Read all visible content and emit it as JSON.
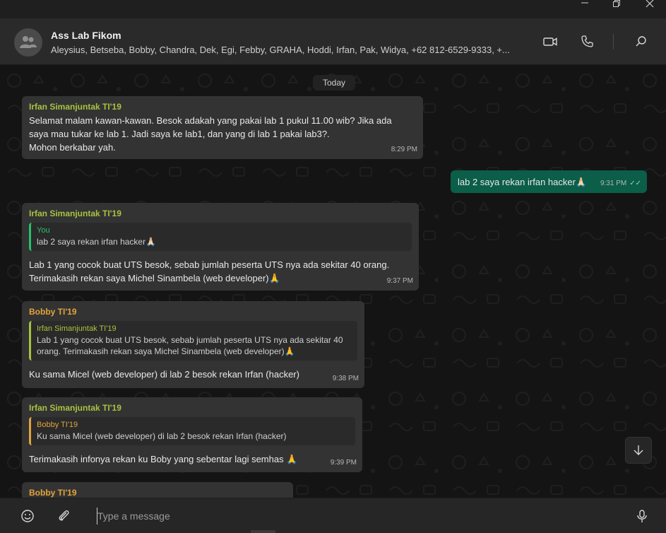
{
  "window": {
    "controls": {
      "minimize": "minimize-icon",
      "maximize": "maximize-icon",
      "close": "close-icon"
    }
  },
  "header": {
    "title": "Ass Lab Fikom",
    "members": "Aleysius, Betseba, Bobby, Chandra, Dek, Egi, Febby, GRAHA, Hoddi, Irfan, Pak, Widya, +62 812-6529-9333, +...",
    "icons": [
      "group-avatar-icon",
      "video-call-icon",
      "voice-call-icon",
      "search-icon"
    ]
  },
  "chat": {
    "date_label": "Today",
    "messages": [
      {
        "sender": "Irfan Simanjuntak TI'19",
        "lines": [
          "Selamat malam kawan-kawan. Besok adakah yang pakai lab 1 pukul 11.00 wib? Jika ada",
          "saya mau tukar ke lab 1. Jadi saya ke lab1, dan yang di lab 1 pakai lab3?.",
          "Mohon berkabar yah."
        ],
        "time": "8:29 PM"
      },
      {
        "sender": "",
        "text": "lab 2 saya rekan irfan hacker🙏🏻",
        "time": "9:31 PM",
        "ticks": "✓✓",
        "outgoing": true
      },
      {
        "sender": "Irfan Simanjuntak TI'19",
        "quote": {
          "name": "You",
          "text": "lab 2 saya rekan irfan hacker🙏🏻"
        },
        "lines": [
          "Lab 1 yang cocok buat UTS besok, sebab jumlah peserta UTS nya ada sekitar 40 orang.",
          "Terimakasih rekan saya Michel Sinambela (web developer)🙏"
        ],
        "time": "9:37 PM"
      },
      {
        "sender": "Bobby TI'19",
        "quote": {
          "name": "Irfan Simanjuntak TI'19",
          "lines": [
            "Lab 1 yang cocok buat UTS besok, sebab jumlah peserta UTS nya ada sekitar 40",
            "orang. Terimakasih rekan saya Michel Sinambela (web developer)🙏"
          ]
        },
        "text": "Ku sama Micel (web developer) di lab 2 besok rekan Irfan (hacker)",
        "time": "9:38 PM"
      },
      {
        "sender": "Irfan Simanjuntak TI'19",
        "quote": {
          "name": "Bobby TI'19",
          "text": "Ku sama Micel (web developer) di lab 2 besok rekan Irfan (hacker)"
        },
        "text": "Terimakasih infonya rekan ku Boby yang sebentar lagi semhas 🙏",
        "time": "9:39 PM"
      },
      {
        "sender": "Bobby TI'19"
      }
    ]
  },
  "composer": {
    "placeholder": "Type a message",
    "icons": [
      "emoji-icon",
      "attach-icon",
      "microphone-icon"
    ]
  },
  "colors": {
    "incoming_bubble": "#333333",
    "outgoing_bubble": "#0b5e48",
    "sender_green": "#a8c23f",
    "sender_orange": "#e2a43b",
    "you_green": "#25c26b"
  }
}
